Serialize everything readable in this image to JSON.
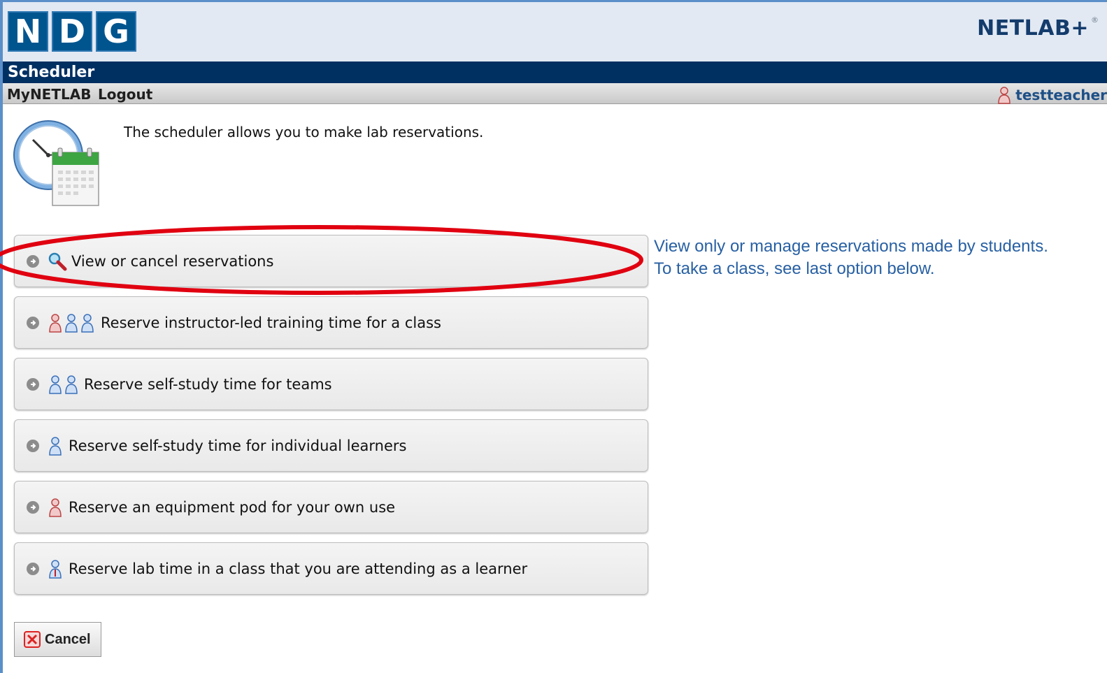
{
  "header": {
    "logo_letters": [
      "N",
      "D",
      "G"
    ],
    "brand": "NETLAB+",
    "brand_mark": "®"
  },
  "title_bar": {
    "title": "Scheduler"
  },
  "menu": {
    "items": [
      "MyNETLAB",
      "Logout"
    ],
    "user": "testteacher"
  },
  "intro": {
    "text": "The scheduler allows you to make lab reservations."
  },
  "options": [
    {
      "label": "View or cancel reservations",
      "icon": "magnifier-icon"
    },
    {
      "label": "Reserve instructor-led training time for a class",
      "icon": "instructor-and-students-icon"
    },
    {
      "label": "Reserve self-study time for teams",
      "icon": "team-users-icon"
    },
    {
      "label": "Reserve self-study time for individual learners",
      "icon": "single-user-icon"
    },
    {
      "label": "Reserve an equipment pod for your own use",
      "icon": "instructor-user-icon"
    },
    {
      "label": "Reserve lab time in a class that you are attending as a learner",
      "icon": "learner-user-icon"
    }
  ],
  "hint": {
    "line1": "View only or manage reservations made by students.",
    "line2": "To take a class, see last option below."
  },
  "cancel_button": {
    "label": "Cancel"
  },
  "colors": {
    "navy": "#002f62",
    "logo_blue": "#00558f",
    "hint_blue": "#2860a3",
    "annotation_red": "#e00010"
  }
}
